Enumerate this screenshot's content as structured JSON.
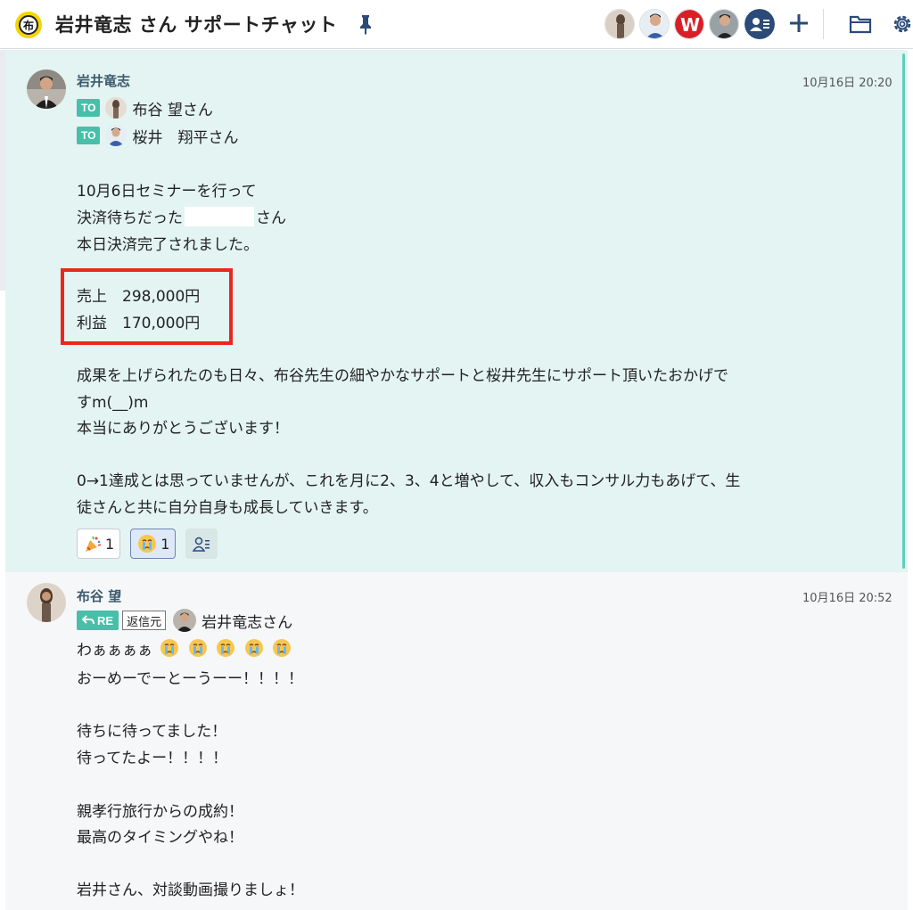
{
  "header": {
    "room_icon_char": "布",
    "title": "岩井竜志 さん サポートチャット"
  },
  "message1": {
    "sender": "岩井竜志",
    "timestamp": "10月16日 20:20",
    "to": [
      {
        "badge": "TO",
        "name": "布谷 望さん"
      },
      {
        "badge": "TO",
        "name": "桜井　翔平さん"
      }
    ],
    "lines": {
      "l1": "10月6日セミナーを行って",
      "l2a": "決済待ちだった",
      "l2b": "さん",
      "l3": "本日決済完了されました。",
      "l4": "売上　298,000円",
      "l5": "利益　170,000円",
      "l6": "成果を上げられたのも日々、布谷先生の細やかなサポートと桜井先生にサポート頂いたおかげで",
      "l7": "すm(__)m",
      "l8": "本当にありがとうございます！",
      "l9": "0→1達成とは思っていませんが、これを月に2、3、4と増やして、収入もコンサル力もあげて、生",
      "l10": "徒さんと共に自分自身も成長していきます。"
    },
    "reactions": [
      {
        "icon": "party-popper-icon",
        "count": "1"
      },
      {
        "icon": "crying-face-icon",
        "count": "1"
      }
    ]
  },
  "message2": {
    "sender": "布谷 望",
    "timestamp": "10月16日 20:52",
    "reply": {
      "badge": "RE",
      "source_label": "返信元",
      "name": "岩井竜志さん"
    },
    "lines": {
      "l1": "わぁぁぁぁ",
      "l2": "おーめーでーとーうーー！！！！",
      "l3": "待ちに待ってました！",
      "l4": "待ってたよー！！！！",
      "l5": "親孝行旅行からの成約！",
      "l6": "最高のタイミングやね！",
      "l7": "岩井さん、対談動画撮りましょ！"
    }
  },
  "colors": {
    "accent": "#47bfa9",
    "highlight_bg": "#e3f4f2",
    "red_box": "#e8281e",
    "header_icon": "#2b4a78"
  }
}
